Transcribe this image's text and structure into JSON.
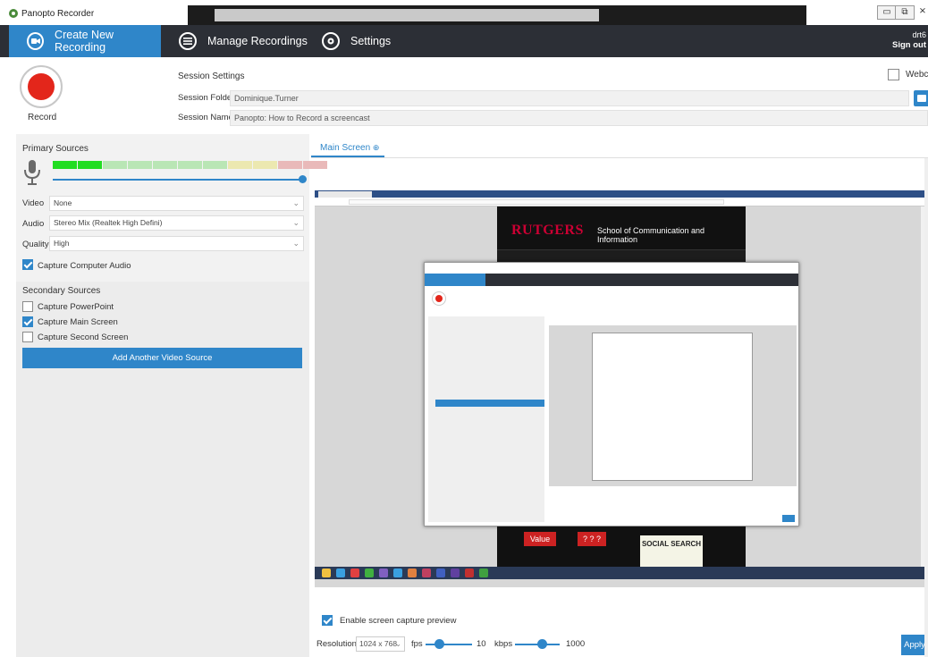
{
  "titlebar": {
    "title": "Panopto Recorder",
    "minimize_icon": "minimize-icon",
    "restore_icon": "restore-icon",
    "close_icon": "close-icon",
    "minimize": "▭",
    "restore": "⧉",
    "close": "⨯"
  },
  "nav": {
    "tabs": [
      {
        "label": "Create New Recording",
        "icon": "camera-icon",
        "active": true
      },
      {
        "label": "Manage Recordings",
        "icon": "list-icon",
        "active": false
      },
      {
        "label": "Settings",
        "icon": "gear-icon",
        "active": false
      }
    ],
    "user": "drt6",
    "sign_out": "Sign out"
  },
  "session": {
    "record_label": "Record",
    "title": "Session Settings",
    "folder_label": "Session Folder",
    "folder_value": "Dominique.Turner",
    "name_label": "Session Name",
    "name_value": "Panopto: How to Record a screencast",
    "webcam_label": "Webcam"
  },
  "primary": {
    "title": "Primary Sources",
    "video_label": "Video",
    "video_value": "None",
    "audio_label": "Audio",
    "audio_value": "Stereo Mix (Realtek High Defini)",
    "quality_label": "Quality",
    "quality_value": "High",
    "capture_audio_label": "Capture Computer Audio",
    "capture_audio_checked": true,
    "meter_colors": [
      "#22dd22",
      "#22dd22",
      "#b9e6b5",
      "#b9e6b5",
      "#b9e6b5",
      "#b9e6b5",
      "#b9e6b5",
      "#ece8b0",
      "#ece8b0",
      "#e9b9b9",
      "#e9b9b9"
    ],
    "audio_level": 1.0
  },
  "secondary": {
    "title": "Secondary Sources",
    "powerpoint_label": "Capture PowerPoint",
    "main_screen_label": "Capture Main Screen",
    "second_screen_label": "Capture Second Screen",
    "add_button": "Add Another Video Source"
  },
  "preview": {
    "tab_label": "Main Screen",
    "rutgers": "RUTGERS",
    "school": "School of Communication and Information",
    "value_tile": "Value",
    "qqq_tile": "? ? ?",
    "social_tile": "SOCIAL SEARCH",
    "enable_label": "Enable screen capture preview",
    "enable_checked": true
  },
  "capture": {
    "resolution_label": "Resolution",
    "resolution_value": "1024 x 768",
    "fps_label": "fps",
    "fps_value": "10",
    "kbps_label": "kbps",
    "kbps_value": "1000",
    "apply": "Apply"
  },
  "colors": {
    "accent": "#2f86c9",
    "nav_bg": "#2c2f36",
    "record_red": "#e3261b"
  }
}
